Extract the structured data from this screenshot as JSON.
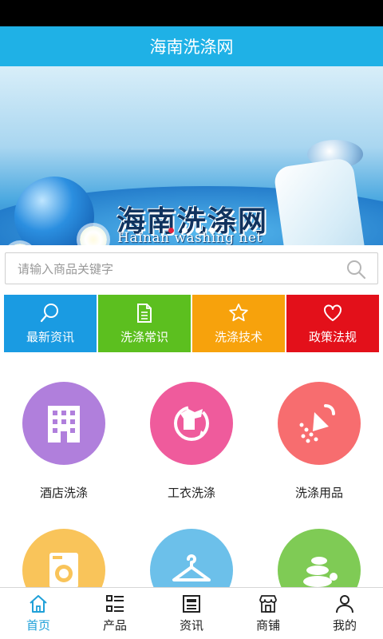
{
  "header": {
    "title": "海南洗涤网"
  },
  "banner": {
    "brand_cn": "海南洗涤网",
    "brand_en": "Hainan washing net",
    "slides": 4,
    "active_slide": 1
  },
  "search": {
    "placeholder": "请输入商品关键字",
    "icon": "search-icon"
  },
  "quick_links": [
    {
      "label": "最新资讯",
      "icon": "search-icon",
      "color": "#1a9be2"
    },
    {
      "label": "洗涤常识",
      "icon": "document-icon",
      "color": "#5cbf1f"
    },
    {
      "label": "洗涤技术",
      "icon": "star-icon",
      "color": "#f7a20c"
    },
    {
      "label": "政策法规",
      "icon": "heart-icon",
      "color": "#e3101a"
    }
  ],
  "categories": [
    {
      "label": "酒店洗涤",
      "icon": "hotel-building-icon",
      "color": "#b07fdc"
    },
    {
      "label": "工衣洗涤",
      "icon": "clothes-spin-icon",
      "color": "#ef5b9c"
    },
    {
      "label": "洗涤用品",
      "icon": "shower-icon",
      "color": "#f76d6f"
    },
    {
      "label": "",
      "icon": "washing-machine-icon",
      "color": "#f9c45a"
    },
    {
      "label": "",
      "icon": "hanger-icon",
      "color": "#6cc0ea"
    },
    {
      "label": "",
      "icon": "spa-stones-icon",
      "color": "#7fcb55"
    }
  ],
  "tabbar": [
    {
      "label": "首页",
      "icon": "home-icon",
      "active": true
    },
    {
      "label": "产品",
      "icon": "list-icon",
      "active": false
    },
    {
      "label": "资讯",
      "icon": "news-icon",
      "active": false
    },
    {
      "label": "商铺",
      "icon": "shop-icon",
      "active": false
    },
    {
      "label": "我的",
      "icon": "user-icon",
      "active": false
    }
  ]
}
